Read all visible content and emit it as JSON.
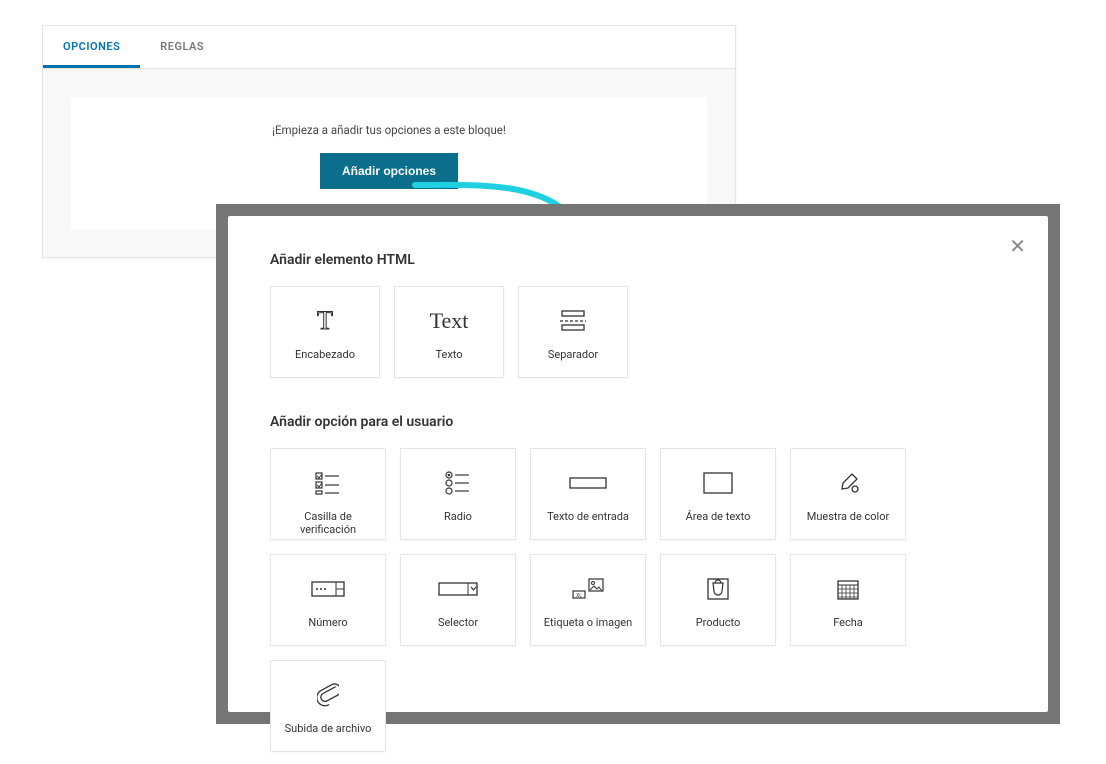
{
  "tabs": {
    "opciones": "OPCIONES",
    "reglas": "REGLAS"
  },
  "panel": {
    "hint": "¡Empieza a añadir tus opciones a este bloque!",
    "add_button": "Añadir opciones"
  },
  "modal": {
    "html_title": "Añadir elemento HTML",
    "user_title": "Añadir opción para el usuario",
    "html_items": {
      "heading": "Encabezado",
      "text": "Texto",
      "separator": "Separador"
    },
    "user_items": {
      "checkbox": "Casilla de verificación",
      "radio": "Radio",
      "textinput": "Texto de entrada",
      "textarea": "Área de texto",
      "colorswatch": "Muestra de color",
      "number": "Número",
      "selector": "Selector",
      "label_image": "Etiqueta o imagen",
      "product": "Producto",
      "date": "Fecha",
      "file": "Subida de archivo"
    }
  }
}
